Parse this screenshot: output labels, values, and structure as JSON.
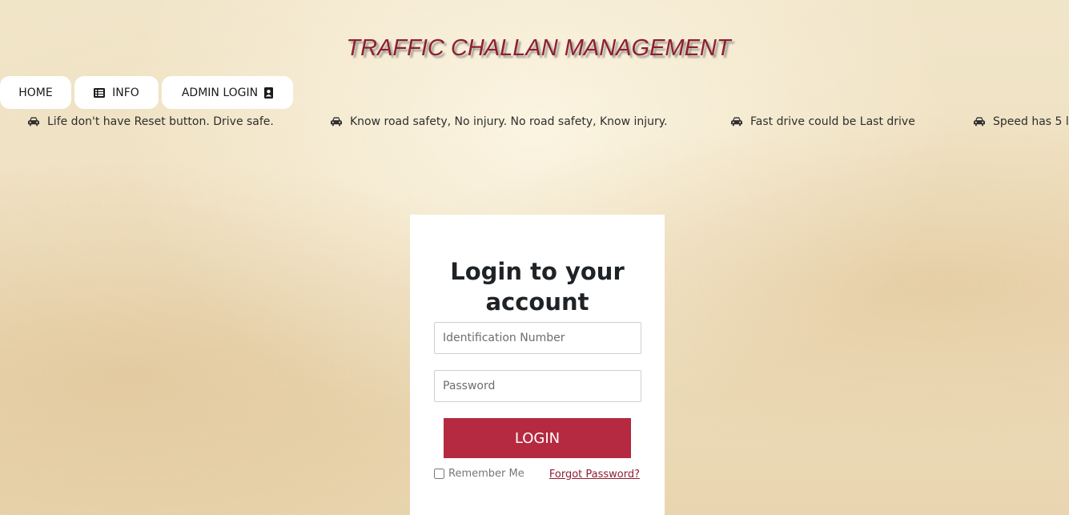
{
  "header": {
    "title": "TRAFFIC CHALLAN MANAGEMENT"
  },
  "nav": {
    "home_label": "HOME",
    "info_label": "INFO",
    "admin_label": "ADMIN LOGIN"
  },
  "marquee": {
    "items": [
      "Life don't have Reset button. Drive safe.",
      "Know road safety, No injury. No road safety, Know injury.",
      "Fast drive could be Last drive",
      "Speed has 5 l"
    ]
  },
  "login": {
    "title_line1": "Login to your",
    "title_line2": "account",
    "id_placeholder": "Identification Number",
    "password_placeholder": "Password",
    "submit_label": "LOGIN",
    "remember_label": "Remember Me",
    "forgot_label": "Forgot Password?"
  },
  "colors": {
    "accent": "#b52a40",
    "title": "#8e1f33"
  }
}
